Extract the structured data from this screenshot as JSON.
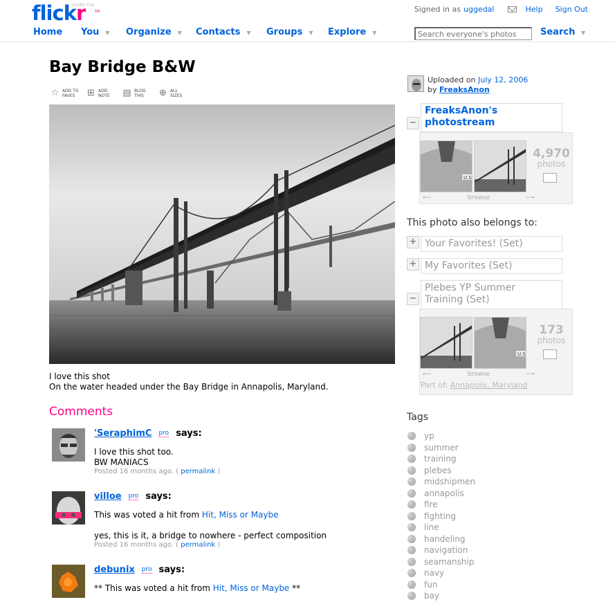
{
  "header": {
    "logo_text": "flick",
    "logo_r": "r",
    "logo_tagline": "LOVES YOU",
    "logo_tm": "TM",
    "signed_in_prefix": "Signed in as",
    "username": "uggedal",
    "help_label": "Help",
    "signout_label": "Sign Out"
  },
  "nav": {
    "items": [
      {
        "label": "Home"
      },
      {
        "label": "You"
      },
      {
        "label": "Organize"
      },
      {
        "label": "Contacts"
      },
      {
        "label": "Groups"
      },
      {
        "label": "Explore"
      }
    ],
    "search_placeholder": "Search everyone's photos",
    "search_label": "Search"
  },
  "photo": {
    "title": "Bay Bridge B&W",
    "tools": [
      {
        "icon": "star-icon",
        "label": "Add to faves"
      },
      {
        "icon": "add-note-icon",
        "label": "Add note"
      },
      {
        "icon": "blog-icon",
        "label": "Blog this"
      },
      {
        "icon": "zoom-icon",
        "label": "All sizes"
      }
    ],
    "desc_line1": "I love this shot",
    "desc_line2": "On the water headed under the Bay Bridge in Annapolis, Maryland."
  },
  "comments": {
    "heading": "Comments",
    "items": [
      {
        "author": "'SeraphimC",
        "pro": "pro",
        "says": "says:",
        "text1": "I love this shot too.",
        "text2": "BW MANIACS",
        "posted": "Posted 16 months ago. (",
        "permalink": "permalink",
        "close": ")"
      },
      {
        "author": "villoe",
        "pro": "pro",
        "says": "says:",
        "text1_prefix": "This was voted a hit from ",
        "text1_link": "Hit, Miss or Maybe",
        "text2": "yes, this is it, a bridge to nowhere - perfect composition",
        "posted": "Posted 16 months ago. (",
        "permalink": "permalink",
        "close": ")"
      },
      {
        "author": "debunix",
        "pro": "pro",
        "says": "says:",
        "text1_prefix": "** This was voted a hit from ",
        "text1_link": "Hit, Miss or Maybe",
        "text1_suffix": " **"
      }
    ]
  },
  "sidebar": {
    "uploaded_prefix": "Uploaded on",
    "uploaded_date": "July 12, 2006",
    "by_prefix": "by",
    "uploader": "FreaksAnon",
    "photostream": {
      "title_line1": "FreaksAnon's",
      "title_line2": "photostream",
      "count": "4,970",
      "unit": "photos",
      "browse": "browse"
    },
    "belongs_heading": "This photo also belongs to:",
    "sets": [
      {
        "name": "Your Favorites! (Set)"
      },
      {
        "name": "My Favorites (Set)"
      }
    ],
    "plebes_set": {
      "title_line1": "Plebes YP Summer",
      "title_line2": "Training (Set)",
      "count": "173",
      "unit": "photos",
      "browse": "browse",
      "part_of_prefix": "Part of:",
      "part_of_link": "Annapolis, Maryland"
    },
    "tags_heading": "Tags",
    "tags": [
      "yp",
      "summer",
      "training",
      "plebes",
      "midshipmen",
      "annapolis",
      "fire",
      "fighting",
      "line",
      "handeling",
      "navigation",
      "seamanship",
      "navy",
      "fun",
      "bay"
    ]
  }
}
